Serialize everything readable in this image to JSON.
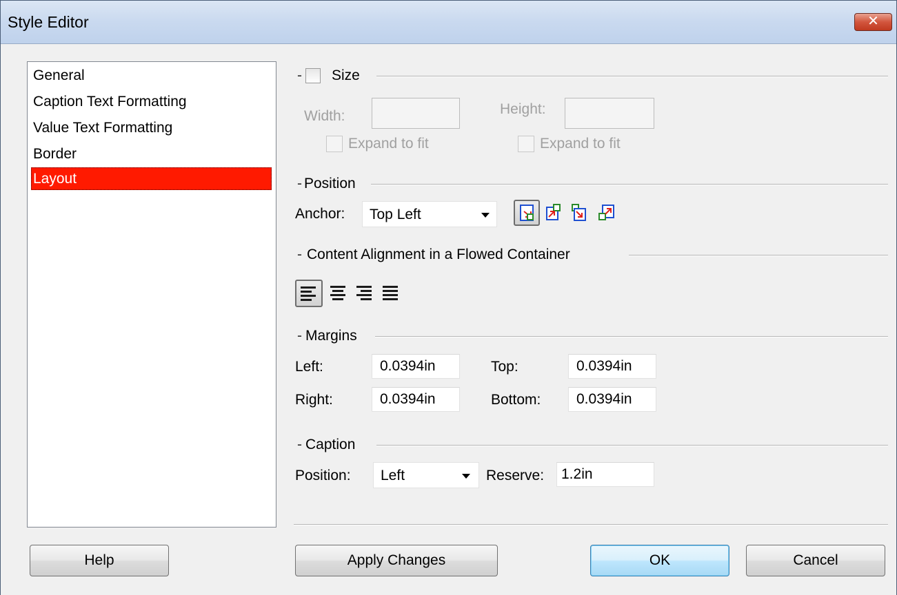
{
  "window": {
    "title": "Style Editor",
    "close_glyph": "✕"
  },
  "nav": {
    "items": [
      {
        "label": "General"
      },
      {
        "label": "Caption Text Formatting"
      },
      {
        "label": "Value Text Formatting"
      },
      {
        "label": "Border"
      },
      {
        "label": "Layout",
        "selected": true
      }
    ]
  },
  "size": {
    "title": "Size",
    "checked": false,
    "width_label": "Width:",
    "height_label": "Height:",
    "width_value": "",
    "height_value": "",
    "expand_width_label": "Expand to fit",
    "expand_height_label": "Expand to fit"
  },
  "position": {
    "title": "Position",
    "anchor_label": "Anchor:",
    "anchor_value": "Top Left",
    "anchor_icons": [
      "anchor-top-left-icon",
      "rotate-90-icon",
      "rotate-180-icon",
      "rotate-270-icon"
    ]
  },
  "alignment": {
    "title": "Content Alignment in a Flowed Container",
    "icons": [
      "align-left-icon",
      "align-center-icon",
      "align-right-icon",
      "justify-icon"
    ]
  },
  "margins": {
    "title": "Margins",
    "left_label": "Left:",
    "left_value": "0.0394in",
    "top_label": "Top:",
    "top_value": "0.0394in",
    "right_label": "Right:",
    "right_value": "0.0394in",
    "bottom_label": "Bottom:",
    "bottom_value": "0.0394in"
  },
  "caption": {
    "title": "Caption",
    "position_label": "Position:",
    "position_value": "Left",
    "reserve_label": "Reserve:",
    "reserve_value": "1.2in"
  },
  "buttons": {
    "help": "Help",
    "apply": "Apply Changes",
    "ok": "OK",
    "cancel": "Cancel"
  },
  "colors": {
    "selected_item_bg": "#ff1a00",
    "title_bar": "#c9d9ef",
    "close_button": "#c03a20",
    "icon_blue": "#1e4fd1",
    "icon_red": "#e0201a",
    "icon_green": "#2a8a2a"
  }
}
